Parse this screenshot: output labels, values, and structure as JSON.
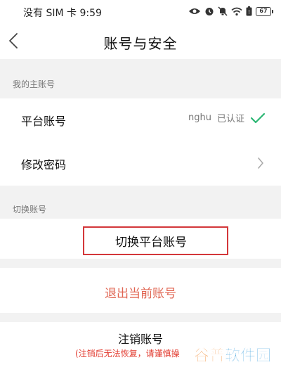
{
  "status_bar": {
    "carrier_time": "没有 SIM 卡 9:59",
    "battery": "67",
    "icons": [
      "eye-icon",
      "alarm-icon",
      "mute-bell-icon",
      "wifi-icon",
      "battery-saver-icon",
      "battery-icon"
    ]
  },
  "nav": {
    "title": "账号与安全",
    "back_icon": "chevron-left-icon"
  },
  "sections": {
    "main_account_label": "我的主账号",
    "switch_account_label": "切换账号"
  },
  "rows": {
    "platform_account": {
      "title": "平台账号",
      "account_name": "nghu",
      "status": "已认证",
      "status_icon": "check-icon"
    },
    "change_password": {
      "title": "修改密码",
      "arrow_icon": "chevron-right-icon"
    }
  },
  "buttons": {
    "switch_platform_account": "切换平台账号",
    "logout_current": "退出当前账号",
    "cancel_account": "注销账号",
    "cancel_account_note": "(注销后无法恢复，请谨慎操"
  },
  "watermark": {
    "part1": "谷普",
    "part2": "软件园"
  },
  "colors": {
    "accent_green": "#2bb673",
    "logout_red": "#e06552",
    "warning_red": "#e23b2f",
    "highlight_red": "#d3373a",
    "background": "#f2f2f2"
  }
}
